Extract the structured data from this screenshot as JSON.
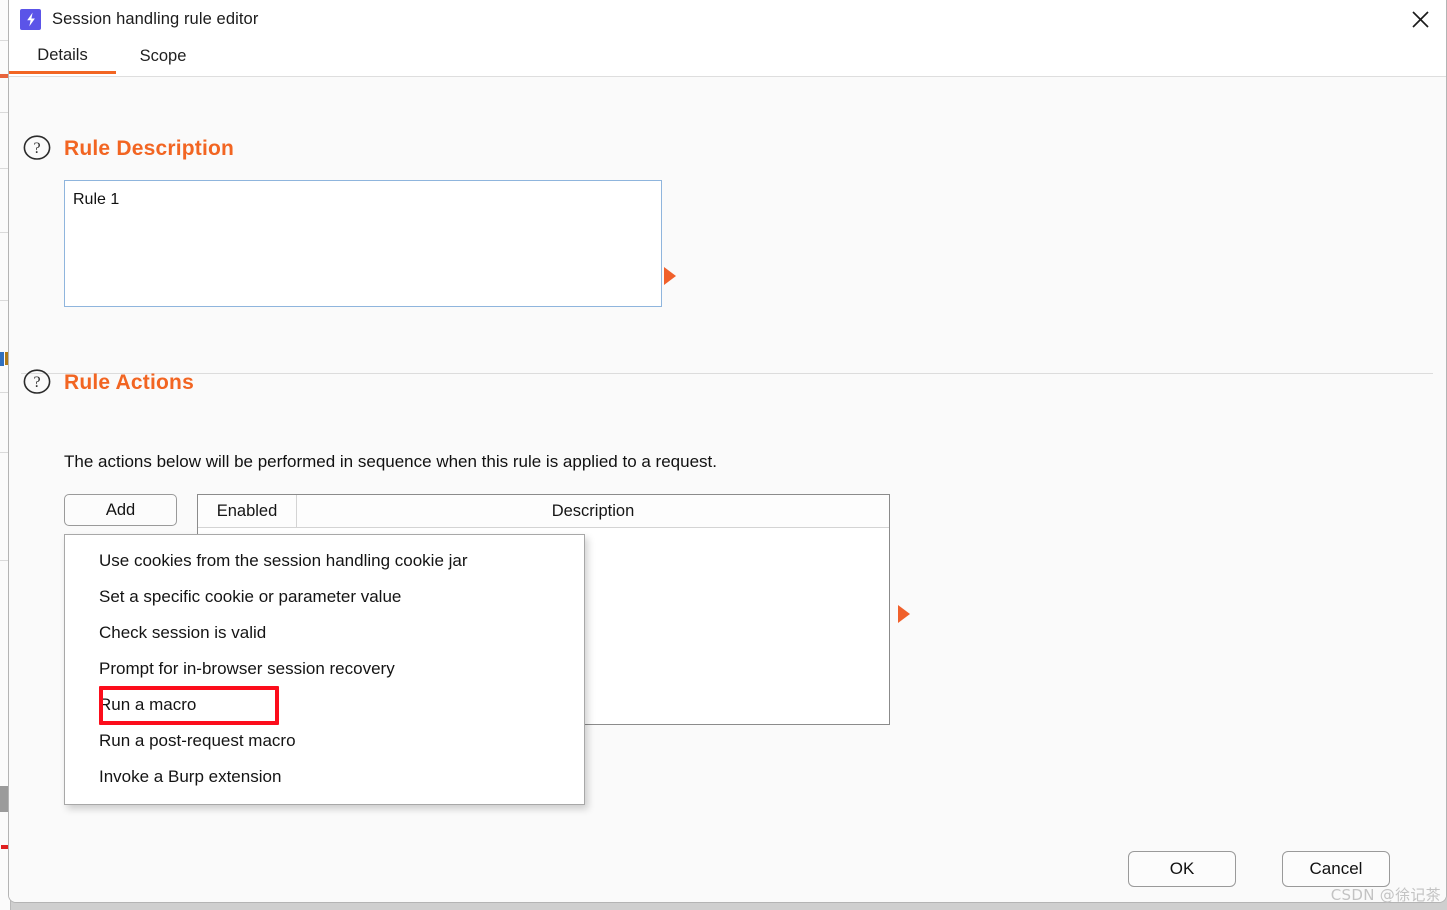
{
  "window": {
    "title": "Session handling rule editor",
    "app_icon": "lightning-bolt-icon",
    "close_icon": "close-icon",
    "accent_color": "#f26522",
    "icon_color": "#5b54e8"
  },
  "tabs": [
    {
      "label": "Details",
      "active": true
    },
    {
      "label": "Scope",
      "active": false
    }
  ],
  "rule_description": {
    "heading": "Rule Description",
    "help_icon": "question-mark-icon",
    "value": "Rule 1",
    "placeholder": "",
    "expand_icon": "play-arrow-icon"
  },
  "rule_actions": {
    "heading": "Rule Actions",
    "help_icon": "question-mark-icon",
    "subtitle": "The actions below will be performed in sequence when this rule is applied to a request.",
    "add_button_label": "Add",
    "table_headers": [
      "Enabled",
      "Description"
    ],
    "table_rows": [],
    "expand_icon": "play-arrow-icon"
  },
  "action_menu": {
    "items": [
      {
        "label": "Use cookies from the session handling cookie jar",
        "highlighted": false
      },
      {
        "label": "Set a specific cookie or parameter value",
        "highlighted": false
      },
      {
        "label": "Check session is valid",
        "highlighted": false
      },
      {
        "label": "Prompt for in-browser session recovery",
        "highlighted": false
      },
      {
        "label": "Run a macro",
        "highlighted": true
      },
      {
        "label": "Run a post-request macro",
        "highlighted": false
      },
      {
        "label": "Invoke a Burp extension",
        "highlighted": false
      }
    ],
    "highlight_color": "#fc0d1b"
  },
  "footer": {
    "ok_label": "OK",
    "cancel_label": "Cancel"
  },
  "watermark": {
    "text": "CSDN @徐记茶"
  }
}
